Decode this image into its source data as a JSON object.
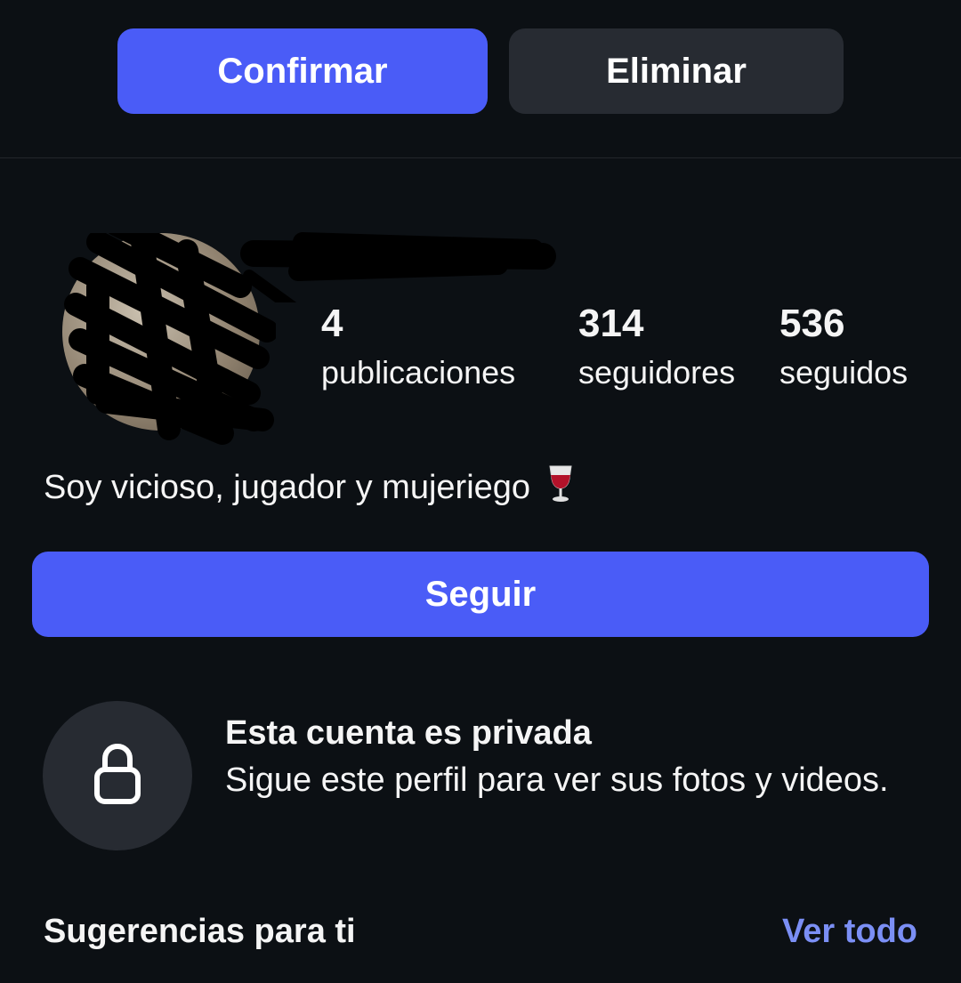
{
  "request": {
    "confirm_label": "Confirmar",
    "delete_label": "Eliminar"
  },
  "profile": {
    "stats": [
      {
        "value": "4",
        "label": "publicaciones"
      },
      {
        "value": "314",
        "label": "seguidores"
      },
      {
        "value": "536",
        "label": "seguidos"
      }
    ],
    "bio": "Soy vicioso, jugador y mujeriego",
    "follow_label": "Seguir"
  },
  "private_notice": {
    "title": "Esta cuenta es privada",
    "description": "Sigue este perfil para ver sus fotos y videos."
  },
  "suggestions": {
    "title": "Sugerencias para ti",
    "see_all_label": "Ver todo"
  },
  "colors": {
    "background": "#0c1014",
    "accent": "#4a5cf7",
    "secondary_button": "#272b32",
    "link": "#7b8ff5"
  },
  "icons": {
    "bio_emoji": "wine-glass-icon",
    "private": "lock-icon"
  }
}
